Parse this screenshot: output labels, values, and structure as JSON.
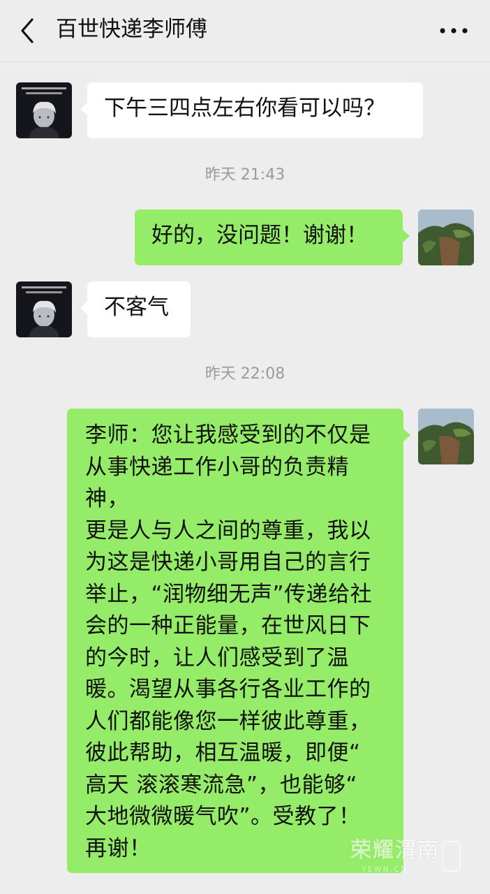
{
  "header": {
    "title": "百世快递李师傅",
    "back_icon": "chevron-left-icon",
    "more_icon": "more-dots-icon"
  },
  "messages": [
    {
      "side": "left",
      "text": "下午三四点左右你看可以吗？"
    },
    {
      "type": "time",
      "text": "昨天 21:43"
    },
    {
      "side": "right",
      "text": "好的，没问题！谢谢！"
    },
    {
      "side": "left",
      "text": "不客气"
    },
    {
      "type": "time",
      "text": "昨天 22:08"
    },
    {
      "side": "right",
      "text": "李师：您让我感受到的不仅是\n从事快递工作小哥的负责精神，\n更是人与人之间的尊重，我以\n为这是快递小哥用自己的言行\n举止，“润物细无声”传递给社\n会的一种正能量，在世风日下\n的今时，让人们感受到了温\n暖。渴望从事各行各业工作的\n人们都能像您一样彼此尊重，\n彼此帮助，相互温暖，即便“\n高天 滚滚寒流急”，也能够“\n大地微微暖气吹”。受教了！\n再谢！"
    }
  ],
  "watermark": {
    "brand": "荣耀渭南",
    "sub": "YEWN.CN"
  },
  "colors": {
    "background": "#ededed",
    "bubble_right": "#95ec69",
    "bubble_left": "#ffffff",
    "timestamp": "#9a9a9a"
  }
}
